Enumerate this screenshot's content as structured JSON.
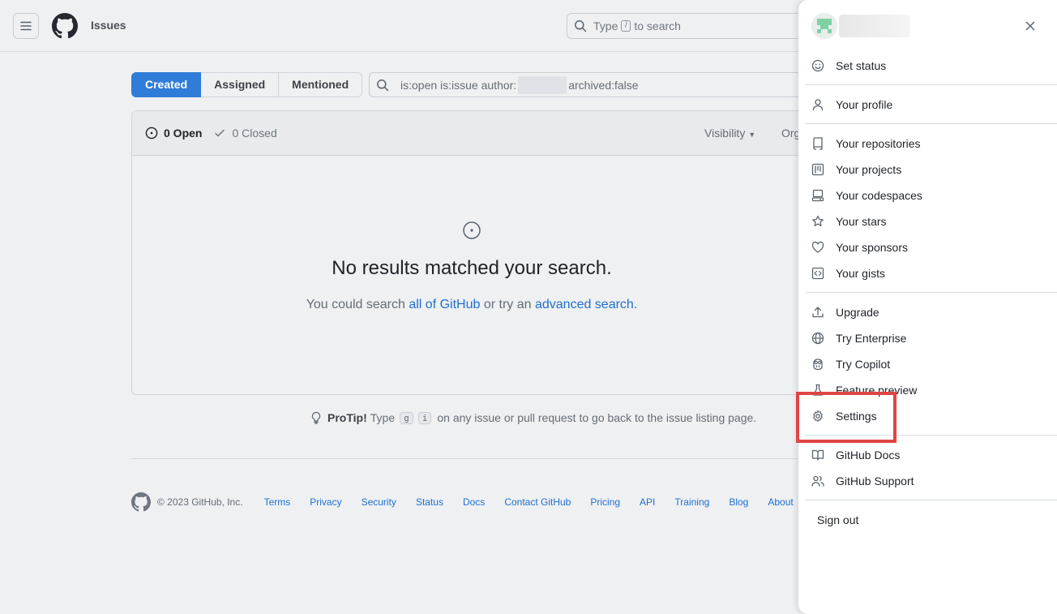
{
  "header": {
    "context": "Issues",
    "search_prefix": "Type",
    "search_key": "/",
    "search_suffix": "to search"
  },
  "subnav": {
    "tabs": [
      {
        "label": "Created",
        "active": true
      },
      {
        "label": "Assigned",
        "active": false
      },
      {
        "label": "Mentioned",
        "active": false
      }
    ]
  },
  "filter": {
    "prefix": "is:open is:issue author:",
    "suffix": "archived:false"
  },
  "issues_box": {
    "open_label": "0 Open",
    "closed_label": "0 Closed",
    "visibility_label": "Visibility",
    "org_label": "Org"
  },
  "blankslate": {
    "title": "No results matched your search.",
    "text_before": "You could search",
    "link1": "all of GitHub",
    "text_middle": "or try an",
    "link2": "advanced search."
  },
  "protip": {
    "label": "ProTip!",
    "text_before": "Type",
    "key1": "g",
    "key2": "i",
    "text_after": "on any issue or pull request to go back to the issue listing page."
  },
  "footer": {
    "copyright": "© 2023 GitHub, Inc.",
    "links": [
      "Terms",
      "Privacy",
      "Security",
      "Status",
      "Docs",
      "Contact GitHub",
      "Pricing",
      "API",
      "Training",
      "Blog",
      "About"
    ]
  },
  "drawer": {
    "items": {
      "set_status": "Set status",
      "your_profile": "Your profile",
      "your_repositories": "Your repositories",
      "your_projects": "Your projects",
      "your_codespaces": "Your codespaces",
      "your_stars": "Your stars",
      "your_sponsors": "Your sponsors",
      "your_gists": "Your gists",
      "upgrade": "Upgrade",
      "try_enterprise": "Try Enterprise",
      "try_copilot": "Try Copilot",
      "feature_preview": "Feature preview",
      "settings": "Settings",
      "github_docs": "GitHub Docs",
      "github_support": "GitHub Support",
      "sign_out": "Sign out"
    }
  },
  "colors": {
    "accent": "#2f7cd9",
    "link": "#1f6fd0",
    "highlight": "#e04545"
  }
}
